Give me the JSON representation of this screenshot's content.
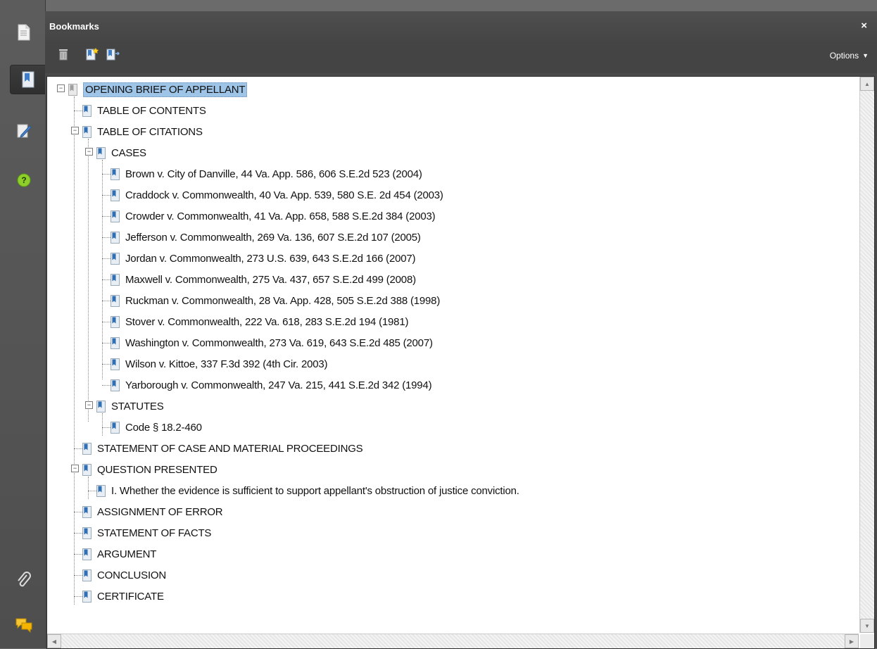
{
  "panel": {
    "title": "Bookmarks",
    "close_symbol": "×",
    "options_label": "Options",
    "options_caret": "▼"
  },
  "rail": {
    "icons": [
      "pages-icon",
      "bookmarks-icon",
      "signatures-icon",
      "help-icon",
      "attachments-icon",
      "comments-icon"
    ]
  },
  "toolbar": {
    "icons": [
      "delete-bookmark-icon",
      "new-bookmark-icon",
      "expand-bookmark-icon"
    ]
  },
  "tree": {
    "root": "OPENING BRIEF OF APPELLANT",
    "toc": "TABLE OF CONTENTS",
    "citations": "TABLE OF CITATIONS",
    "cases": "CASES",
    "case_items": [
      "Brown v. City of Danville, 44 Va. App. 586, 606 S.E.2d 523 (2004)",
      "Craddock v. Commonwealth, 40 Va. App. 539, 580 S.E. 2d 454 (2003)",
      "Crowder v. Commonwealth, 41 Va. App. 658, 588 S.E.2d 384 (2003)",
      "Jefferson v. Commonwealth, 269 Va. 136, 607 S.E.2d 107 (2005)",
      "Jordan v. Commonwealth, 273 U.S. 639, 643 S.E.2d 166 (2007)",
      "Maxwell v. Commonwealth, 275 Va. 437, 657 S.E.2d 499 (2008)",
      "Ruckman v. Commonwealth, 28 Va. App. 428, 505 S.E.2d 388 (1998)",
      "Stover v. Commonwealth, 222 Va. 618, 283 S.E.2d 194 (1981)",
      "Washington v. Commonwealth, 273 Va. 619, 643 S.E.2d 485 (2007)",
      "Wilson v. Kittoe, 337 F.3d 392 (4th Cir. 2003)",
      "Yarborough v. Commonwealth, 247 Va. 215, 441 S.E.2d 342 (1994)"
    ],
    "statutes": "STATUTES",
    "statute_items": [
      "Code § 18.2-460"
    ],
    "statement_case": "STATEMENT OF CASE AND MATERIAL PROCEEDINGS",
    "question": "QUESTION PRESENTED",
    "question_items": [
      "I. Whether the evidence is sufficient to support appellant's obstruction of justice conviction."
    ],
    "assignment": "ASSIGNMENT OF ERROR",
    "facts": "STATEMENT OF FACTS",
    "argument": "ARGUMENT",
    "conclusion": "CONCLUSION",
    "certificate": "CERTIFICATE"
  },
  "colors": {
    "selection": "#9ec5e8",
    "bookmark_blue": "#2f6fb6"
  }
}
